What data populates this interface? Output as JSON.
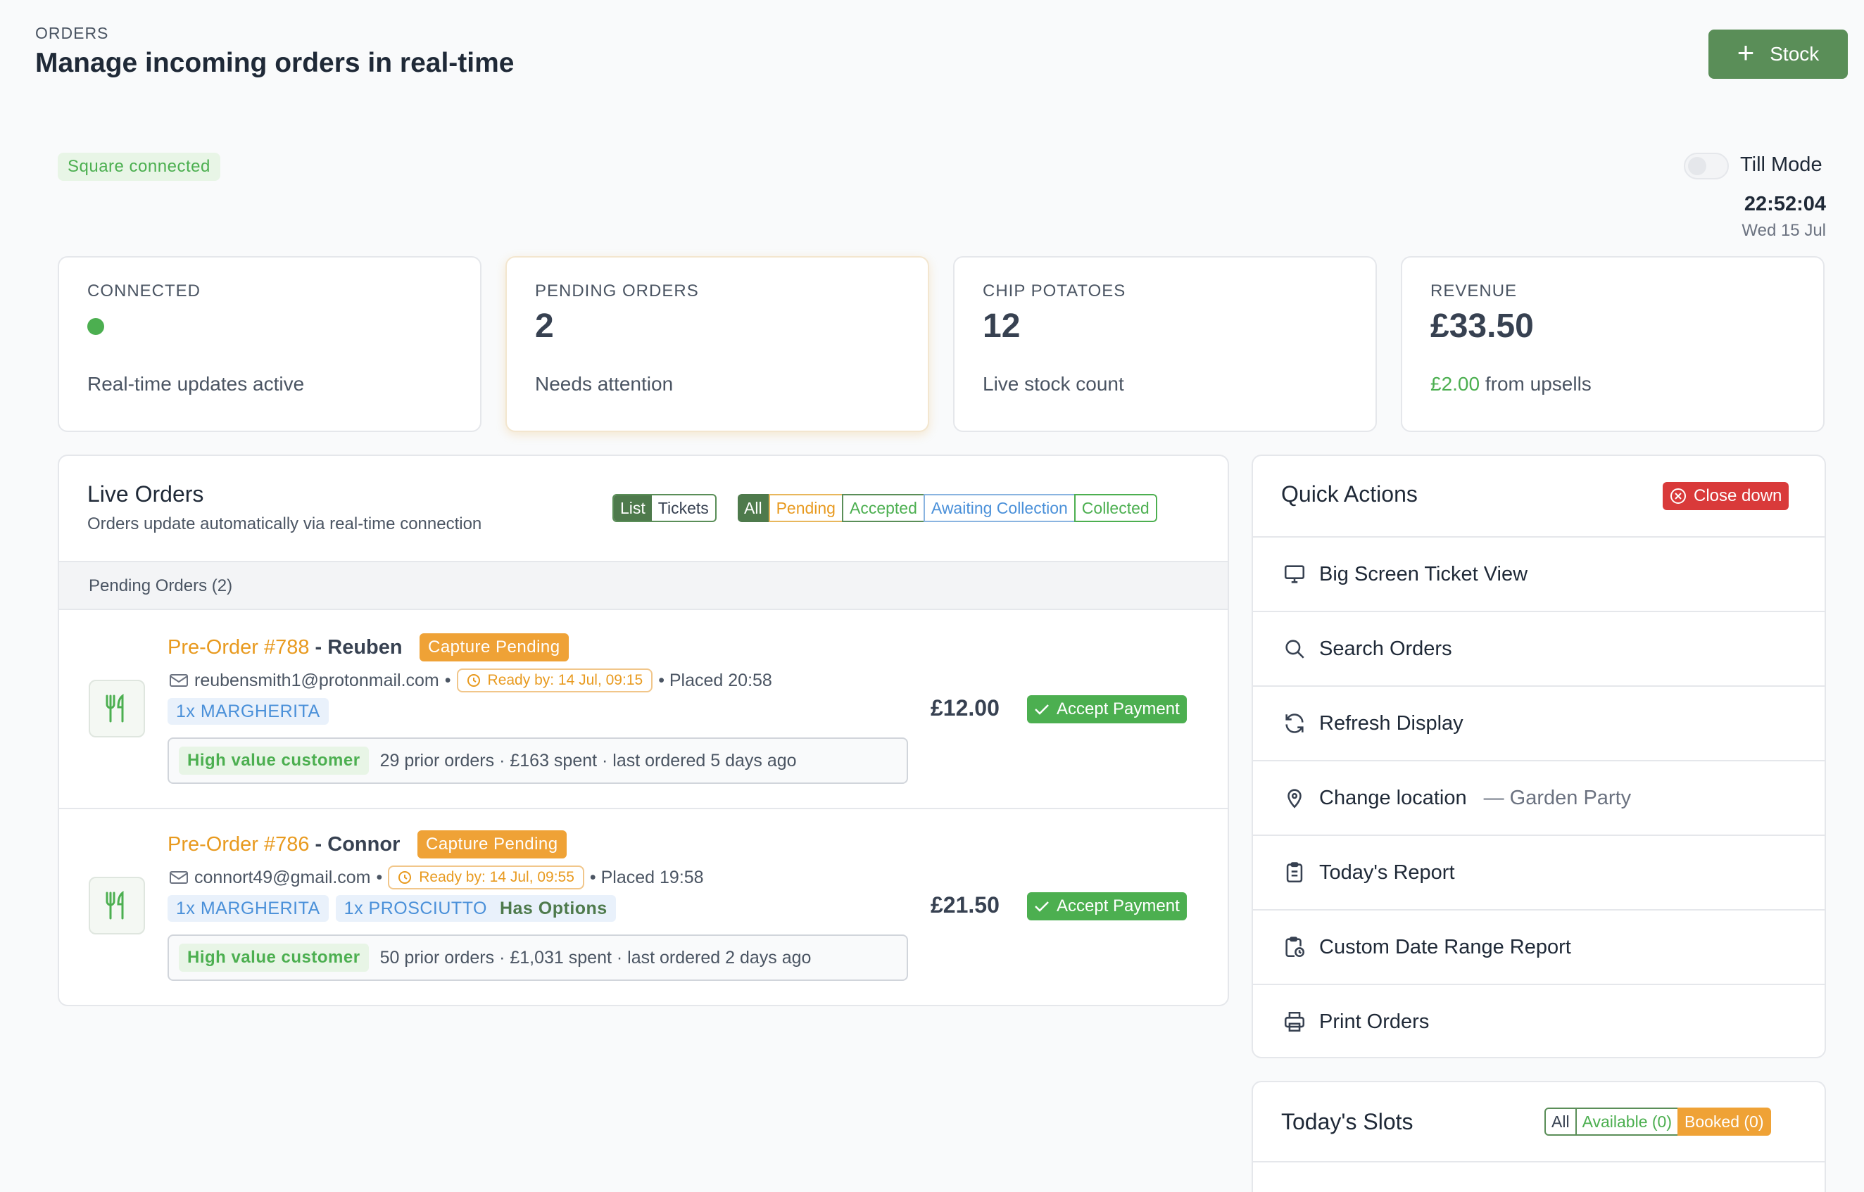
{
  "header": {
    "eyebrow": "ORDERS",
    "title": "Manage incoming orders in real-time",
    "stock_button": "Stock"
  },
  "status": {
    "square_badge": "Square connected",
    "till_mode_label": "Till Mode",
    "till_mode_on": false,
    "time": "22:52:04",
    "date": "Wed 15 Jul"
  },
  "stats": [
    {
      "label": "CONNECTED",
      "value": "",
      "sub": "Real-time updates active"
    },
    {
      "label": "PENDING ORDERS",
      "value": "2",
      "sub": "Needs attention"
    },
    {
      "label": "CHIP POTATOES",
      "value": "12",
      "sub": "Live stock count"
    },
    {
      "label": "REVENUE",
      "value": "£33.50",
      "sub_highlight": "£2.00",
      "sub": " from upsells"
    }
  ],
  "live_orders": {
    "title": "Live Orders",
    "subtitle": "Orders update automatically via real-time connection",
    "view_toggle": [
      "List",
      "Tickets"
    ],
    "filters": [
      "All",
      "Pending",
      "Accepted",
      "Awaiting Collection",
      "Collected"
    ],
    "section_label": "Pending Orders (2)",
    "orders": [
      {
        "number": "Pre-Order #788",
        "customer": " - Reuben",
        "status_badge": "Capture Pending",
        "email": "reubensmith1@protonmail.com",
        "sep": "•",
        "ready_by": "Ready by: 14 Jul, 09:15",
        "placed": "• Placed 20:58",
        "items": [
          {
            "label": "1x MARGHERITA",
            "options": ""
          }
        ],
        "customer_badge": "High value customer",
        "customer_stats": "29 prior orders · £163 spent · last ordered 5 days ago",
        "price": "£12.00",
        "action": "Accept Payment"
      },
      {
        "number": "Pre-Order #786",
        "customer": " - Connor",
        "status_badge": "Capture Pending",
        "email": "connort49@gmail.com",
        "sep": "•",
        "ready_by": "Ready by: 14 Jul, 09:55",
        "placed": "• Placed 19:58",
        "items": [
          {
            "label": "1x MARGHERITA",
            "options": ""
          },
          {
            "label": "1x PROSCIUTTO",
            "options": "Has Options"
          }
        ],
        "customer_badge": "High value customer",
        "customer_stats": "50 prior orders · £1,031 spent · last ordered 2 days ago",
        "price": "£21.50",
        "action": "Accept Payment"
      }
    ]
  },
  "quick_actions": {
    "title": "Quick Actions",
    "close_down": "Close down",
    "items": [
      {
        "label": "Big Screen Ticket View",
        "icon": "monitor-icon",
        "extra": ""
      },
      {
        "label": "Search Orders",
        "icon": "search-icon",
        "extra": ""
      },
      {
        "label": "Refresh Display",
        "icon": "refresh-icon",
        "extra": ""
      },
      {
        "label": "Change location",
        "icon": "location-pin-icon",
        "extra": "— Garden Party"
      },
      {
        "label": "Today's Report",
        "icon": "clipboard-icon",
        "extra": ""
      },
      {
        "label": "Custom Date Range Report",
        "icon": "clipboard-calendar-icon",
        "extra": ""
      },
      {
        "label": "Print Orders",
        "icon": "printer-icon",
        "extra": ""
      }
    ]
  },
  "slots": {
    "title": "Today's Slots",
    "filters": [
      "All",
      "Available (0)",
      "Booked (0)"
    ]
  },
  "colors": {
    "brand_green": "#5a8e58",
    "success_green": "#4caf50",
    "pending_orange": "#efa236",
    "danger_red": "#d93a3a",
    "info_blue": "#4a90d9"
  }
}
